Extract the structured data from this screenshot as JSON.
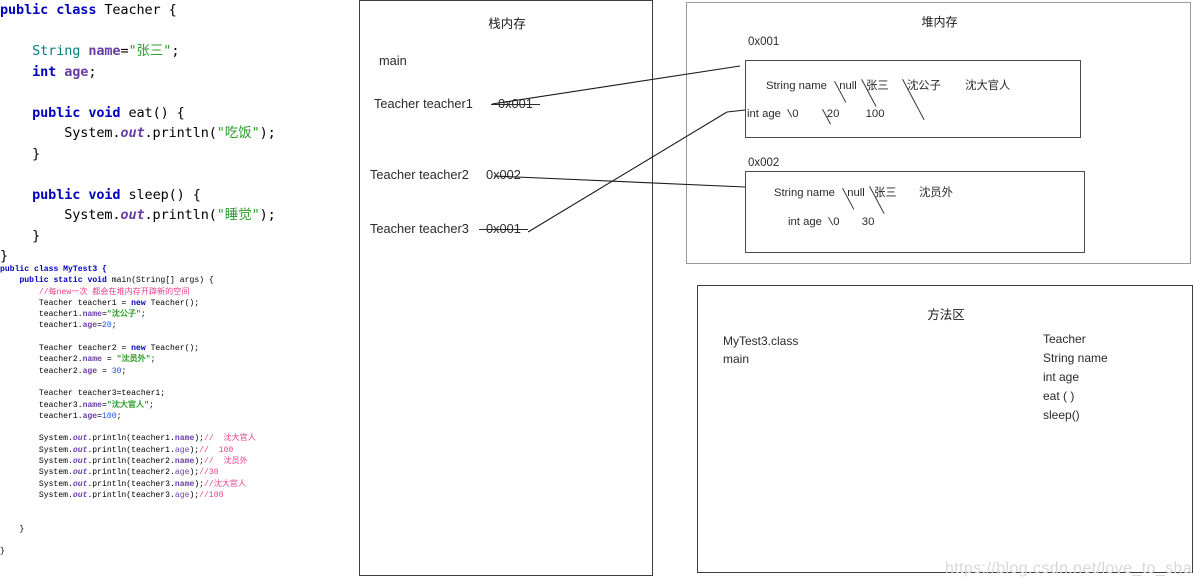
{
  "code_top": {
    "title": "Teacher class source",
    "lines": [
      [
        {
          "t": "public",
          "c": "kw"
        },
        {
          "t": " ",
          "c": "pln"
        },
        {
          "t": "class",
          "c": "kw"
        },
        {
          "t": " Teacher {",
          "c": "pln"
        }
      ],
      [
        {
          "t": "",
          "c": "pln"
        }
      ],
      [
        {
          "t": "    ",
          "c": "pln"
        },
        {
          "t": "String",
          "c": "typ"
        },
        {
          "t": " ",
          "c": "pln"
        },
        {
          "t": "name",
          "c": "fld"
        },
        {
          "t": "=",
          "c": "pln"
        },
        {
          "t": "\"张三\"",
          "c": "str"
        },
        {
          "t": ";",
          "c": "pln"
        }
      ],
      [
        {
          "t": "    ",
          "c": "pln"
        },
        {
          "t": "int",
          "c": "kw"
        },
        {
          "t": " ",
          "c": "pln"
        },
        {
          "t": "age",
          "c": "fld"
        },
        {
          "t": ";",
          "c": "pln"
        }
      ],
      [
        {
          "t": "",
          "c": "pln"
        }
      ],
      [
        {
          "t": "    ",
          "c": "pln"
        },
        {
          "t": "public",
          "c": "kw"
        },
        {
          "t": " ",
          "c": "pln"
        },
        {
          "t": "void",
          "c": "kw"
        },
        {
          "t": " eat() {",
          "c": "pln"
        }
      ],
      [
        {
          "t": "        System.",
          "c": "pln"
        },
        {
          "t": "out",
          "c": "ital"
        },
        {
          "t": ".println(",
          "c": "pln"
        },
        {
          "t": "\"吃饭\"",
          "c": "str"
        },
        {
          "t": ");",
          "c": "pln"
        }
      ],
      [
        {
          "t": "    }",
          "c": "pln"
        }
      ],
      [
        {
          "t": "",
          "c": "pln"
        }
      ],
      [
        {
          "t": "    ",
          "c": "pln"
        },
        {
          "t": "public",
          "c": "kw"
        },
        {
          "t": " ",
          "c": "pln"
        },
        {
          "t": "void",
          "c": "kw"
        },
        {
          "t": " sleep() {",
          "c": "pln"
        }
      ],
      [
        {
          "t": "        System.",
          "c": "pln"
        },
        {
          "t": "out",
          "c": "ital"
        },
        {
          "t": ".println(",
          "c": "pln"
        },
        {
          "t": "\"睡觉\"",
          "c": "str"
        },
        {
          "t": ");",
          "c": "pln"
        }
      ],
      [
        {
          "t": "    }",
          "c": "pln"
        }
      ],
      [
        {
          "t": "}",
          "c": "pln"
        }
      ]
    ]
  },
  "code_bottom": {
    "title": "MyTest3 class source",
    "lines": [
      [
        {
          "t": "public",
          "c": "plnb"
        },
        {
          "t": " ",
          "c": "pln"
        },
        {
          "t": "class",
          "c": "plnb"
        },
        {
          "t": " ",
          "c": "pln"
        },
        {
          "t": "MyTest3 {",
          "c": "plnb"
        }
      ],
      [
        {
          "t": "    ",
          "c": "pln"
        },
        {
          "t": "public",
          "c": "plnb"
        },
        {
          "t": " ",
          "c": "pln"
        },
        {
          "t": "static",
          "c": "plnb"
        },
        {
          "t": " ",
          "c": "pln"
        },
        {
          "t": "void",
          "c": "plnb"
        },
        {
          "t": " main(String[] args) {",
          "c": "pln"
        }
      ],
      [
        {
          "t": "        ",
          "c": "pln"
        },
        {
          "t": "//每new一次 都会在堆内存开辟新的空间",
          "c": "cmt"
        }
      ],
      [
        {
          "t": "        Teacher teacher1 = ",
          "c": "pln"
        },
        {
          "t": "new",
          "c": "plnb"
        },
        {
          "t": " Teacher();",
          "c": "pln"
        }
      ],
      [
        {
          "t": "        teacher1.",
          "c": "pln"
        },
        {
          "t": "name",
          "c": "fld"
        },
        {
          "t": "=",
          "c": "pln"
        },
        {
          "t": "\"沈公子\"",
          "c": "strb"
        },
        {
          "t": ";",
          "c": "pln"
        }
      ],
      [
        {
          "t": "        teacher1.",
          "c": "pln"
        },
        {
          "t": "age",
          "c": "fld"
        },
        {
          "t": "=",
          "c": "pln"
        },
        {
          "t": "20",
          "c": "num"
        },
        {
          "t": ";",
          "c": "pln"
        }
      ],
      [
        {
          "t": "",
          "c": "pln"
        }
      ],
      [
        {
          "t": "        Teacher teacher2 = ",
          "c": "pln"
        },
        {
          "t": "new",
          "c": "plnb"
        },
        {
          "t": " Teacher();",
          "c": "pln"
        }
      ],
      [
        {
          "t": "        teacher2.",
          "c": "pln"
        },
        {
          "t": "name",
          "c": "fld"
        },
        {
          "t": " = ",
          "c": "pln"
        },
        {
          "t": "\"沈员外\"",
          "c": "strb"
        },
        {
          "t": ";",
          "c": "pln"
        }
      ],
      [
        {
          "t": "        teacher2.",
          "c": "pln"
        },
        {
          "t": "age",
          "c": "fld"
        },
        {
          "t": " = ",
          "c": "pln"
        },
        {
          "t": "30",
          "c": "num"
        },
        {
          "t": ";",
          "c": "pln"
        }
      ],
      [
        {
          "t": "",
          "c": "pln"
        }
      ],
      [
        {
          "t": "        Teacher teacher3=teacher1;",
          "c": "pln"
        }
      ],
      [
        {
          "t": "        teacher3.",
          "c": "pln"
        },
        {
          "t": "name",
          "c": "fld"
        },
        {
          "t": "=",
          "c": "pln"
        },
        {
          "t": "\"沈大官人\"",
          "c": "strb"
        },
        {
          "t": ";",
          "c": "pln"
        }
      ],
      [
        {
          "t": "        teacher1.",
          "c": "pln"
        },
        {
          "t": "age",
          "c": "fld"
        },
        {
          "t": "=",
          "c": "pln"
        },
        {
          "t": "100",
          "c": "num"
        },
        {
          "t": ";",
          "c": "pln"
        }
      ],
      [
        {
          "t": "",
          "c": "pln"
        }
      ],
      [
        {
          "t": "        System.",
          "c": "pln"
        },
        {
          "t": "out",
          "c": "ital"
        },
        {
          "t": ".println(teacher1.",
          "c": "pln"
        },
        {
          "t": "name",
          "c": "fld"
        },
        {
          "t": ");",
          "c": "pln"
        },
        {
          "t": "//  沈大官人",
          "c": "cmt"
        }
      ],
      [
        {
          "t": "        System.",
          "c": "pln"
        },
        {
          "t": "out",
          "c": "ital"
        },
        {
          "t": ".println(teacher1.",
          "c": "pln"
        },
        {
          "t": "age",
          "c": "fld2"
        },
        {
          "t": ");",
          "c": "pln"
        },
        {
          "t": "//  100",
          "c": "cmt"
        }
      ],
      [
        {
          "t": "        System.",
          "c": "pln"
        },
        {
          "t": "out",
          "c": "ital"
        },
        {
          "t": ".println(teacher2.",
          "c": "pln"
        },
        {
          "t": "name",
          "c": "fld"
        },
        {
          "t": ");",
          "c": "pln"
        },
        {
          "t": "//  沈员外",
          "c": "cmt"
        }
      ],
      [
        {
          "t": "        System.",
          "c": "pln"
        },
        {
          "t": "out",
          "c": "ital"
        },
        {
          "t": ".println(teacher2.",
          "c": "pln"
        },
        {
          "t": "age",
          "c": "fld2"
        },
        {
          "t": ");",
          "c": "pln"
        },
        {
          "t": "//30",
          "c": "cmt"
        }
      ],
      [
        {
          "t": "        System.",
          "c": "pln"
        },
        {
          "t": "out",
          "c": "ital"
        },
        {
          "t": ".println(teacher3.",
          "c": "pln"
        },
        {
          "t": "name",
          "c": "fld"
        },
        {
          "t": ");",
          "c": "pln"
        },
        {
          "t": "//沈大官人",
          "c": "cmt"
        }
      ],
      [
        {
          "t": "        System.",
          "c": "pln"
        },
        {
          "t": "out",
          "c": "ital"
        },
        {
          "t": ".println(teacher3.",
          "c": "pln"
        },
        {
          "t": "age",
          "c": "fld2"
        },
        {
          "t": ");",
          "c": "pln"
        },
        {
          "t": "//100",
          "c": "cmt"
        }
      ],
      [
        {
          "t": "",
          "c": "pln"
        }
      ],
      [
        {
          "t": "",
          "c": "pln"
        }
      ],
      [
        {
          "t": "    }",
          "c": "pln"
        }
      ],
      [
        {
          "t": "",
          "c": "pln"
        }
      ],
      [
        {
          "t": "}",
          "c": "pln"
        }
      ]
    ]
  },
  "stack": {
    "title": "栈内存",
    "frame_label": "main",
    "rows": [
      {
        "name": "Teacher teacher1",
        "address": "0x001",
        "struck": true
      },
      {
        "name": "Teacher teacher2",
        "address": "0x002",
        "struck": false
      },
      {
        "name": "Teacher teacher3",
        "address": "0x001",
        "struck": true
      }
    ]
  },
  "heap": {
    "title": "堆内存",
    "objects": [
      {
        "address_label": "0x001",
        "name_field": {
          "label": "String name",
          "values": [
            "null",
            "张三",
            "沈公子",
            "沈大官人"
          ],
          "struck": [
            true,
            true,
            true,
            false
          ]
        },
        "age_field": {
          "label": "int age",
          "values": [
            "0",
            "20",
            "100"
          ],
          "struck": [
            true,
            true,
            false
          ]
        }
      },
      {
        "address_label": "0x002",
        "name_field": {
          "label": "String name",
          "values": [
            "null",
            "张三",
            "沈员外"
          ],
          "struck": [
            true,
            true,
            false
          ]
        },
        "age_field": {
          "label": "int age",
          "values": [
            "0",
            "30"
          ],
          "struck": [
            true,
            false
          ]
        }
      }
    ]
  },
  "method_area": {
    "title": "方法区",
    "left_items": [
      "MyTest3.class",
      "main"
    ],
    "right_items": [
      "Teacher",
      "String name",
      "int age",
      "eat (  )",
      "sleep()"
    ]
  },
  "watermark": {
    "text": "https://blog.csdn.net/love_to_share"
  },
  "colors": {
    "keyword": "#0000c0",
    "type": "#008080",
    "field": "#6a3ca8",
    "string": "#2a9d2a",
    "number": "#1750eb",
    "comment": "#e83e8c",
    "panel_border": "#3d3d3d",
    "heap_border": "#9a9a9a",
    "watermark": "#d8d8d8"
  }
}
